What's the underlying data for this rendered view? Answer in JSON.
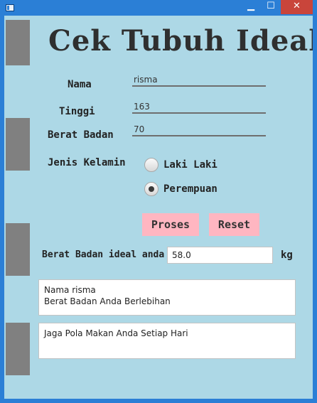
{
  "window": {
    "minimize_glyph": "▁",
    "maximize_glyph": "☐",
    "close_glyph": "✕",
    "icons": {
      "app": "window-app-icon",
      "minimize": "minimize-icon",
      "maximize": "maximize-icon",
      "close": "close-icon"
    },
    "colors": {
      "titlebar": "#2b7fd6",
      "close": "#c9453b"
    }
  },
  "app": {
    "title": "Cek Tubuh Ideal",
    "background": "#add8e6",
    "accent_button": "#ffb6c1"
  },
  "form": {
    "nama_label": "Nama",
    "nama_value": "risma",
    "tinggi_label": "Tinggi",
    "tinggi_value": "163",
    "berat_label": "Berat Badan",
    "berat_value": "70",
    "gender_label": "Jenis Kelamin",
    "gender_options": [
      {
        "label": "Laki Laki",
        "selected": false
      },
      {
        "label": "Perempuan",
        "selected": true
      }
    ]
  },
  "actions": {
    "proses_label": "Proses",
    "reset_label": "Reset"
  },
  "result": {
    "ideal_label": "Berat Badan ideal anda",
    "ideal_value": "58.0",
    "unit": "kg",
    "summary_lines": [
      "Nama risma",
      "Berat Badan Anda Berlebihan"
    ],
    "advice": "Jaga Pola Makan Anda Setiap Hari"
  }
}
